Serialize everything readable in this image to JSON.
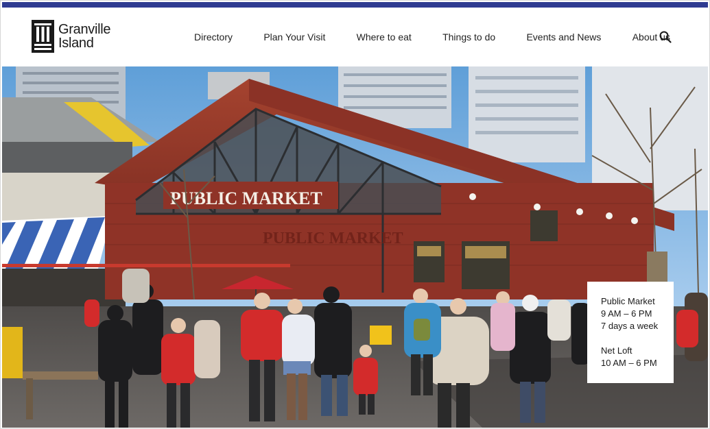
{
  "brand": {
    "name_line1": "Granville",
    "name_line2": "Island"
  },
  "nav": {
    "items": [
      {
        "label": "Directory"
      },
      {
        "label": "Plan Your Visit"
      },
      {
        "label": "Where to eat"
      },
      {
        "label": "Things to do"
      },
      {
        "label": "Events and News"
      },
      {
        "label": "About us"
      }
    ],
    "search_icon": "search-icon"
  },
  "hero": {
    "sign_text": "PUBLIC MARKET",
    "wall_text": "PUBLIC MARKET",
    "image_description_icon": "market-photo"
  },
  "hours": {
    "market_name": "Public Market",
    "market_time": "9 AM – 6 PM",
    "market_days": "7 days a week",
    "loft_name": "Net Loft",
    "loft_time": "10 AM – 6 PM"
  },
  "colors": {
    "accent_bar": "#2f3b91",
    "text": "#1f1f1f",
    "barn_red": "#9a3428"
  }
}
